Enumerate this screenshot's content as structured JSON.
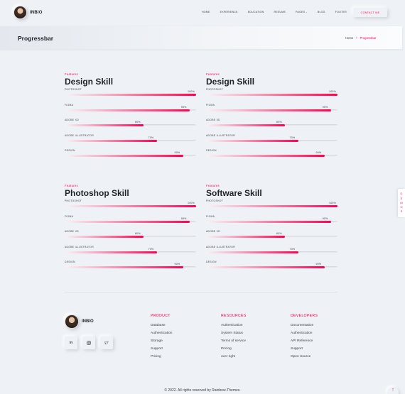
{
  "header": {
    "logo_text": "INBIO",
    "nav": [
      "HOME",
      "EXPERIENCE",
      "EDUCATION",
      "RESUME",
      "PAGES",
      "BLOG",
      "FOOTER"
    ],
    "contact_label": "CONTACT ME"
  },
  "banner": {
    "title": "Progressbar",
    "crumb_home": "Home",
    "crumb_current": "Progressbar"
  },
  "blocks": [
    {
      "sub": "Features",
      "title": "Design Skill",
      "skills": [
        {
          "label": "PHOTOSHOT",
          "pct": "100%",
          "value": 100
        },
        {
          "label": "FIGMA",
          "pct": "95%",
          "value": 95
        },
        {
          "label": "ADOBE XD",
          "pct": "60%",
          "value": 60
        },
        {
          "label": "ADOBE ILLUSTRATOR",
          "pct": "70%",
          "value": 70
        },
        {
          "label": "DESIGN",
          "pct": "90%",
          "value": 90
        }
      ]
    },
    {
      "sub": "Features",
      "title": "Design Skill",
      "skills": [
        {
          "label": "PHOTOSHOT",
          "pct": "100%",
          "value": 100
        },
        {
          "label": "FIGMA",
          "pct": "95%",
          "value": 95
        },
        {
          "label": "ADOBE XD",
          "pct": "60%",
          "value": 60
        },
        {
          "label": "ADOBE ILLUSTRATOR",
          "pct": "70%",
          "value": 70
        },
        {
          "label": "DESIGN",
          "pct": "90%",
          "value": 90
        }
      ]
    },
    {
      "sub": "Features",
      "title": "Photoshop Skill",
      "skills": [
        {
          "label": "PHOTOSHOT",
          "pct": "100%",
          "value": 100
        },
        {
          "label": "FIGMA",
          "pct": "95%",
          "value": 95
        },
        {
          "label": "ADOBE XD",
          "pct": "60%",
          "value": 60
        },
        {
          "label": "ADOBE ILLUSTRATOR",
          "pct": "70%",
          "value": 70
        },
        {
          "label": "DESIGN",
          "pct": "90%",
          "value": 90
        }
      ]
    },
    {
      "sub": "Features",
      "title": "Software Skill",
      "skills": [
        {
          "label": "PHOTOSHOT",
          "pct": "100%",
          "value": 100
        },
        {
          "label": "FIGMA",
          "pct": "95%",
          "value": 95
        },
        {
          "label": "ADOBE XD",
          "pct": "60%",
          "value": 60
        },
        {
          "label": "ADOBE ILLUSTRATOR",
          "pct": "70%",
          "value": 70
        },
        {
          "label": "DESIGN",
          "pct": "90%",
          "value": 90
        }
      ]
    }
  ],
  "footer": {
    "logo_text": "INBIO",
    "socials": [
      "linkedin-icon",
      "instagram-icon",
      "twitter-icon"
    ],
    "columns": [
      {
        "title": "PRODUCT",
        "links": [
          "Database",
          "Authentication",
          "Storage",
          "Support",
          "Pricing"
        ]
      },
      {
        "title": "RESOURCES",
        "links": [
          "Authentication",
          "System Status",
          "Terms of service",
          "Pricing",
          "over right"
        ]
      },
      {
        "title": "DEVELOPERS",
        "links": [
          "Documentation",
          "Authentication",
          "API Reference",
          "Support",
          "Open Source"
        ]
      }
    ],
    "copyright": "© 2022. All rights reserved by Rainbow-Themes."
  },
  "side_tab": {
    "text": "DEMOS"
  },
  "accent_color": "#ff014f"
}
